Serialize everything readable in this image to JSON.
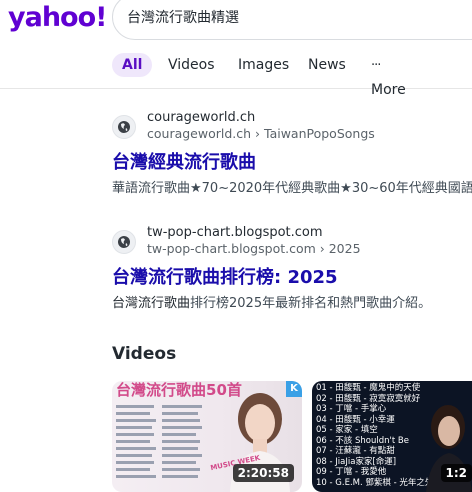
{
  "logo": "yahoo!",
  "search": {
    "query": "台灣流行歌曲精選"
  },
  "tabs": [
    {
      "label": "All",
      "active": true
    },
    {
      "label": "Videos"
    },
    {
      "label": "Images"
    },
    {
      "label": "News"
    },
    {
      "label": "More"
    }
  ],
  "results": [
    {
      "site_name": "courageworld.ch",
      "breadcrumb": "courageworld.ch › TaiwanPopoSongs",
      "title": "台灣經典流行歌曲",
      "snippet": "華語流行歌曲★70~2020年代經典歌曲★30~60年代經典國語"
    },
    {
      "site_name": "tw-pop-chart.blogspot.com",
      "breadcrumb": "tw-pop-chart.blogspot.com › 2025",
      "title": "台灣流行歌曲排行榜: 2025",
      "snippet_bold": "台灣流行歌曲",
      "snippet_rest": "排行榜2025年最新排名和熱門歌曲介紹。"
    }
  ],
  "videos": {
    "heading": "Videos",
    "items": [
      {
        "overlay_title": "台灣流行歌曲50首",
        "badge": "K",
        "watermark": "MUSIC WEEK",
        "duration": "2:20:58"
      },
      {
        "tracks": [
          "01 - 田馥甄 - 魔鬼中的天使",
          "02 - 田馥甄 - 寂寞寂寞就好",
          "03 - 丁噹 - 手掌心",
          "04 - 田馥甄 - 小幸運",
          "05 - 家家 - 填空",
          "06 - 不該 Shouldn't Be",
          "07 - 汪蘇瀧 - 有點甜",
          "08 - JiaJia家家[命運]",
          "09 - 丁噹 - 我愛他",
          "10 - G.E.M. 鄧紫棋 - 光年之外"
        ],
        "duration": "1:2"
      }
    ]
  },
  "colors": {
    "brand": "#6001d2",
    "link": "#1a0dab",
    "active_tab_bg": "#efe7fb"
  }
}
